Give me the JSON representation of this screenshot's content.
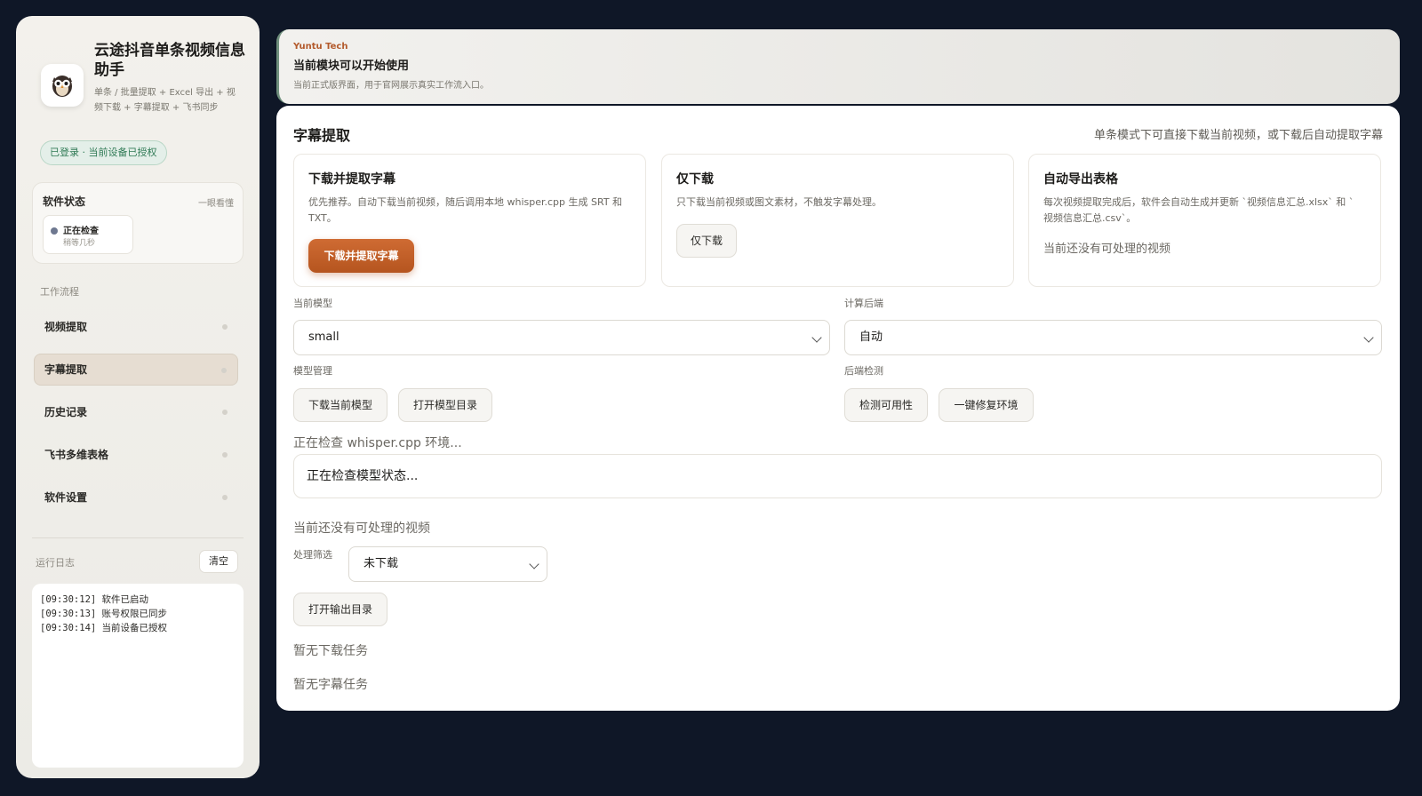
{
  "sidebar": {
    "brand_title": "云途抖音单条视频信息助手",
    "brand_subtitle": "单条 / 批量提取 + Excel 导出 + 视频下载 + 字幕提取 + 飞书同步",
    "login_badge": "已登录 · 当前设备已授权",
    "status": {
      "title": "软件状态",
      "hint": "一眼看懂",
      "state_main": "正在检查",
      "state_sub": "稍等几秒"
    },
    "workflow_label": "工作流程",
    "nav_items": [
      {
        "label": "视频提取",
        "active": false
      },
      {
        "label": "字幕提取",
        "active": true
      },
      {
        "label": "历史记录",
        "active": false
      },
      {
        "label": "飞书多维表格",
        "active": false
      },
      {
        "label": "软件设置",
        "active": false
      }
    ],
    "log_label": "运行日志",
    "clear_label": "清空",
    "logs": [
      "[09:30:12] 软件已启动",
      "[09:30:13] 账号权限已同步",
      "[09:30:14] 当前设备已授权"
    ]
  },
  "notice": {
    "brand": "Yuntu Tech",
    "title": "当前模块可以开始使用",
    "description": "当前正式版界面，用于官网展示真实工作流入口。"
  },
  "main": {
    "title": "字幕提取",
    "hint": "单条模式下可直接下载当前视频，或下载后自动提取字幕",
    "cards": {
      "extract": {
        "title": "下载并提取字幕",
        "description": "优先推荐。自动下载当前视频，随后调用本地 whisper.cpp 生成 SRT 和 TXT。",
        "button": "下载并提取字幕"
      },
      "download": {
        "title": "仅下载",
        "description": "只下载当前视频或图文素材，不触发字幕处理。",
        "button": "仅下载"
      },
      "export": {
        "title": "自动导出表格",
        "description": "每次视频提取完成后，软件会自动生成并更新 `视频信息汇总.xlsx` 和 `视频信息汇总.csv`。",
        "empty": "当前还没有可处理的视频"
      }
    },
    "model_label": "当前模型",
    "model_value": "small",
    "backend_label": "计算后端",
    "backend_value": "自动",
    "model_mgmt_label": "模型管理",
    "download_model_btn": "下载当前模型",
    "open_model_dir_btn": "打开模型目录",
    "backend_check_label": "后端检测",
    "check_btn": "检测可用性",
    "fix_btn": "一键修复环境",
    "whisper_status": "正在检查 whisper.cpp 环境...",
    "model_status": "正在检查模型状态...",
    "no_video": "当前还没有可处理的视频",
    "filter_label": "处理筛选",
    "filter_value": "未下载",
    "open_output_btn": "打开输出目录",
    "no_download_tasks": "暂无下载任务",
    "no_subtitle_tasks": "暂无字幕任务"
  },
  "icons": {
    "logo": "owl-logo-icon",
    "select_chevron": "chevron-down-icon"
  },
  "colors": {
    "background": "#0f1727",
    "accent": "#c4602a",
    "login_badge": "#2f7a55"
  }
}
